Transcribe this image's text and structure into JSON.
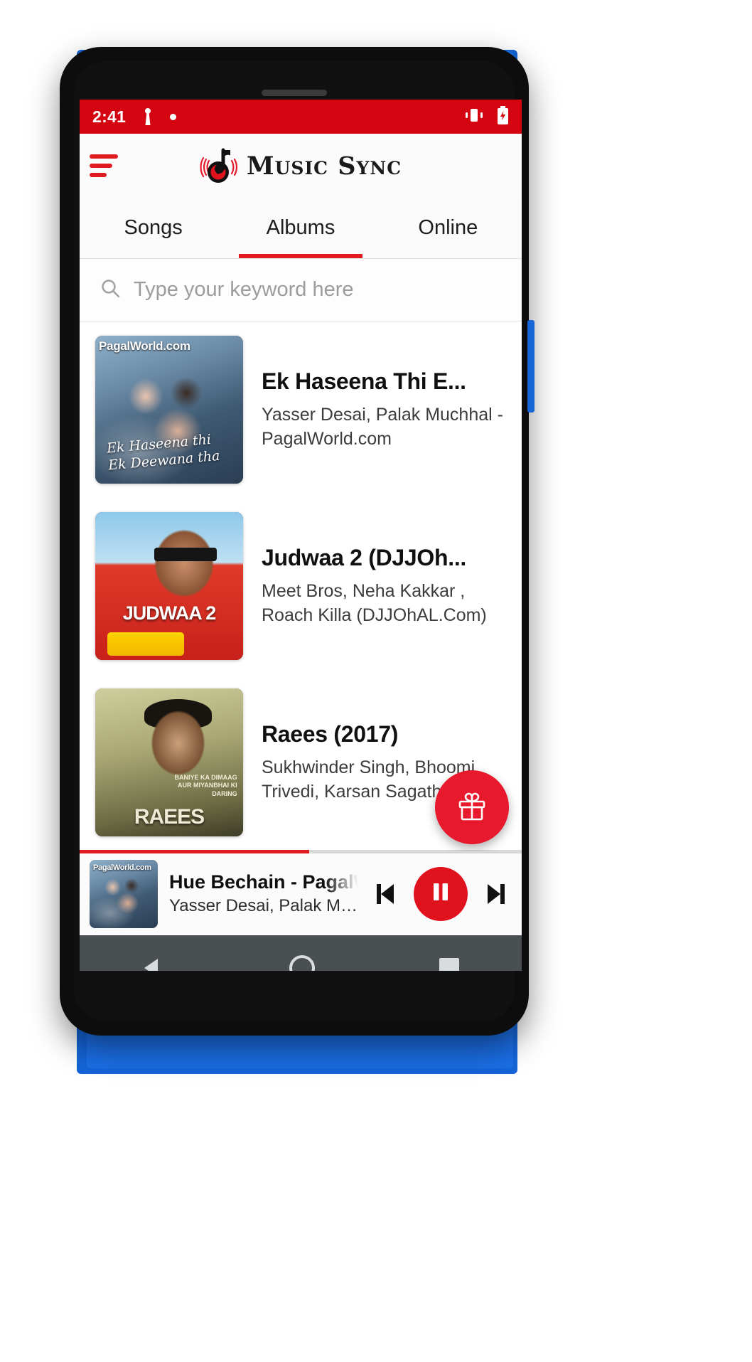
{
  "statusbar": {
    "time": "2:41",
    "notification_icon": "notification-icon",
    "dot_icon": "dot-indicator-icon",
    "vibrate_icon": "vibrate-icon",
    "battery_icon": "battery-charging-icon"
  },
  "appbar": {
    "menu_icon": "hamburger-menu-icon",
    "logo_icon": "music-note-record-logo",
    "title": "Music Sync"
  },
  "tabs": [
    {
      "label": "Songs",
      "active": false
    },
    {
      "label": "Albums",
      "active": true
    },
    {
      "label": "Online",
      "active": false
    }
  ],
  "search": {
    "icon": "search-icon",
    "placeholder": "Type your keyword here",
    "value": ""
  },
  "albums": [
    {
      "title": "Ek Haseena Thi E...",
      "subtitle": "Yasser Desai, Palak Muchhal - PagalWorld.com",
      "art_watermark": "PagalWorld.com",
      "art_script": "Ek Haseena thi Ek Deewana tha",
      "art_name": "album-art-ek-haseena-thi"
    },
    {
      "title": "Judwaa 2 (DJJOh...",
      "subtitle": "Meet Bros, Neha Kakkar , Roach Killa (DJJOhAL.Com)",
      "art_watermark": "",
      "art_script": "JUDWAA 2",
      "art_name": "album-art-judwaa-2"
    },
    {
      "title": "Raees (2017)",
      "subtitle": "Sukhwinder Singh, Bhoomi Trivedi, Karsan Sagathia",
      "art_watermark": "",
      "art_script": "RAEES",
      "art_caption": "BANIYE KA DIMAAG AUR MIYANBHAI KI DARING",
      "art_name": "album-art-raees"
    }
  ],
  "fab": {
    "icon": "gift-icon",
    "label": ""
  },
  "player": {
    "title": "Hue Bechain - PagalWo",
    "subtitle": "Yasser Desai, Palak Muchhal ...",
    "art_watermark": "PagalWorld.com",
    "progress_percent": 52,
    "prev_icon": "skip-previous-icon",
    "play_icon": "pause-icon",
    "next_icon": "skip-next-icon"
  },
  "navbar": {
    "back": "android-back-icon",
    "home": "android-home-icon",
    "recents": "android-recents-icon"
  },
  "colors": {
    "accent": "#e11b22",
    "status_bar": "#d40511",
    "fab": "#e8192c",
    "play_button": "#e0121e",
    "nav_bar": "#4a4f52",
    "phone_body": "#0d0d0d",
    "backdrop_blue": "#1565d8"
  }
}
